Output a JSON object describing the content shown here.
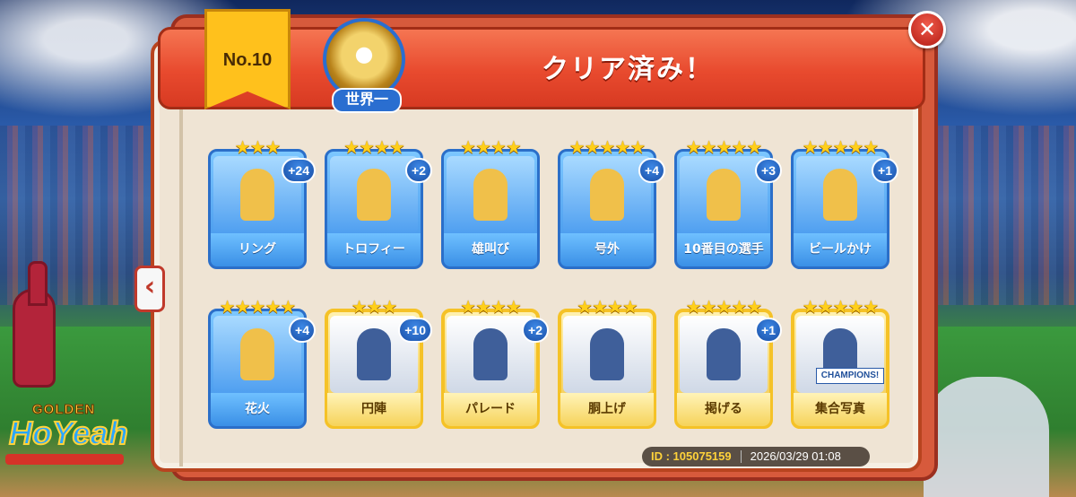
{
  "header": {
    "ribbon_label": "No.10",
    "title": "クリア済み！",
    "medal_label": "世界一"
  },
  "cards": [
    {
      "label": "リング",
      "stars": "★★★",
      "badge": "+24",
      "style": "blue",
      "art": "ring-icon"
    },
    {
      "label": "トロフィー",
      "stars": "★★★★",
      "badge": "+2",
      "style": "blue",
      "art": "trophy-icon"
    },
    {
      "label": "雄叫び",
      "stars": "★★★★",
      "badge": "",
      "style": "blue",
      "art": "player-icon"
    },
    {
      "label": "号外",
      "stars": "★★★★★",
      "badge": "+4",
      "style": "blue",
      "art": "newspaper-icon"
    },
    {
      "label": "10番目の選手",
      "stars": "★★★★★",
      "badge": "+3",
      "style": "blue",
      "art": "fans-icon"
    },
    {
      "label": "ビールかけ",
      "stars": "★★★★★",
      "badge": "+1",
      "style": "blue",
      "art": "champagne-icon"
    },
    {
      "label": "花火",
      "stars": "★★★★★",
      "badge": "+4",
      "style": "blue",
      "art": "fireworks-icon"
    },
    {
      "label": "円陣",
      "stars": "★★★",
      "badge": "+10",
      "style": "gold",
      "art": "huddle-icon"
    },
    {
      "label": "パレード",
      "stars": "★★★★",
      "badge": "+2",
      "style": "gold",
      "art": "parade-icon"
    },
    {
      "label": "胴上げ",
      "stars": "★★★★",
      "badge": "",
      "style": "gold",
      "art": "toss-icon"
    },
    {
      "label": "掲げる",
      "stars": "★★★★★",
      "badge": "+1",
      "style": "gold",
      "art": "trophy-lift-icon"
    },
    {
      "label": "集合写真",
      "stars": "★★★★★",
      "badge": "",
      "style": "gold",
      "art": "team-photo-icon"
    }
  ],
  "banner_text": "CHAMPIONS!",
  "footer": {
    "id_text": "ID : 105075159",
    "timestamp": "2026/03/29 01:08"
  },
  "logo": {
    "top": "GOLDEN",
    "main": "HoYeah"
  },
  "colors": {
    "header_red": "#e84a2e",
    "ribbon_gold": "#ffc11c",
    "card_blue": "#3c8fe8",
    "card_gold": "#f1c543",
    "star": "#ffcf1a"
  }
}
